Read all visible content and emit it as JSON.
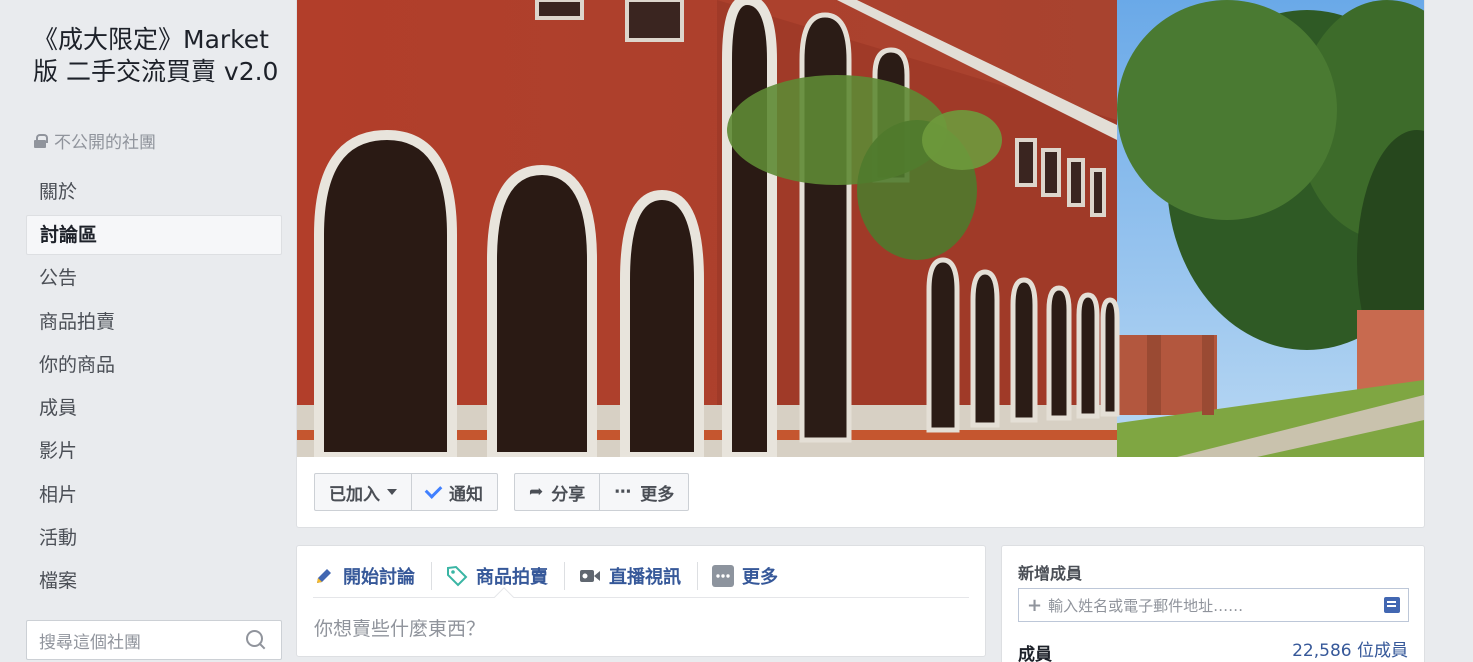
{
  "group": {
    "title": "《成大限定》Market版 二手交流買賣 v2.0",
    "privacy": "不公開的社團"
  },
  "sidebar": {
    "items": [
      {
        "label": "關於"
      },
      {
        "label": "討論區",
        "active": true
      },
      {
        "label": "公告"
      },
      {
        "label": "商品拍賣"
      },
      {
        "label": "你的商品"
      },
      {
        "label": "成員"
      },
      {
        "label": "影片"
      },
      {
        "label": "相片"
      },
      {
        "label": "活動"
      },
      {
        "label": "檔案"
      }
    ],
    "search_placeholder": "搜尋這個社團"
  },
  "actions": {
    "joined": "已加入",
    "notify": "通知",
    "share": "分享",
    "more": "更多"
  },
  "composer": {
    "tabs": [
      {
        "label": "開始討論",
        "icon": "pencil-icon"
      },
      {
        "label": "商品拍賣",
        "icon": "tag-icon"
      },
      {
        "label": "直播視訊",
        "icon": "video-camera-icon"
      },
      {
        "label": "更多",
        "icon": "more-dots-icon"
      }
    ],
    "placeholder": "你想賣些什麼東西？"
  },
  "members": {
    "title": "新增成員",
    "input_placeholder": "輸入姓名或電子郵件地址……",
    "label": "成員",
    "count": "22,586 位成員"
  },
  "colors": {
    "background": "#e9ebee",
    "link": "#365899",
    "accent_blue": "#4080ff",
    "brick": "#b4432f"
  }
}
